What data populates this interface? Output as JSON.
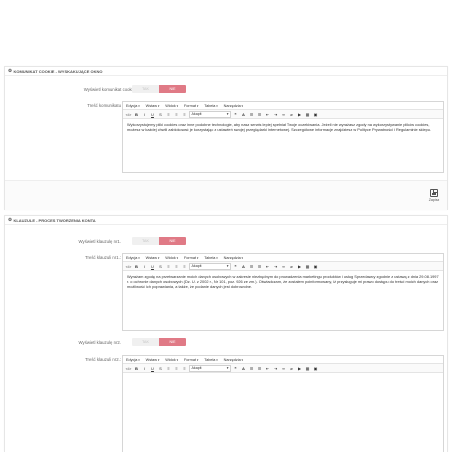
{
  "cookie_panel": {
    "title": "KOMUNIKAT COOKIE - WYSKAKUJĄCE OKNO",
    "display_label": "Wyświetl komunikat cookie",
    "toggle_off": "TAK",
    "toggle_on": "NIE",
    "message_label": "Treść komunikatu",
    "message_text": "Wykorzystujemy pliki cookies oraz inne podobne technologie, aby nasz serwis lepiej spełniał Twoje oczekiwania. Jeżeli nie wyrażasz zgody na wykorzystywanie plików cookies, możesz w każdej chwili zablokować je korzystając z ustawień swojej przeglądarki internetowej. Szczegółowe informacje znajdziesz w Polityce Prywatności i Regulaminie sklepu.",
    "save_label": "Zapisz"
  },
  "consent_panel": {
    "title": "KLAUZULE - PROCES TWORZENIA KONTA",
    "clause1_display_label": "Wyświetl klauzulę nr1.",
    "clause1_text_label": "Treść klauzuli nr1.:",
    "clause1_text": "Wyrażam zgodę na przetwarzanie moich danych osobowych w zakresie niezbędnym do prowadzenia marketingu produktów i usług Sprzedawcy zgodnie z ustawą z dnia 29.08.1997 r. o ochronie danych osobowych (Dz. U. z 2002 r., Nr 101, poz. 926 ze zm.). Oświadczam, że zostałem poinformowany, iż przysługuje mi prawo dostępu do treści moich danych oraz możliwość ich poprawiania, a także, że podanie danych jest dobrowolne.",
    "clause2_display_label": "Wyświetl klauzulę nr2.",
    "clause2_text_label": "Treść klauzuli nr2.:",
    "toggle_off": "TAK",
    "toggle_on": "NIE"
  },
  "editor": {
    "menu": [
      "Edycja",
      "Wstaw",
      "Widok",
      "Format",
      "Tabela",
      "Narzędzia"
    ],
    "font_family": "Akapit"
  },
  "colors": {
    "accent": "#e07a86",
    "toggle_off_bg": "#f0f0f0"
  }
}
